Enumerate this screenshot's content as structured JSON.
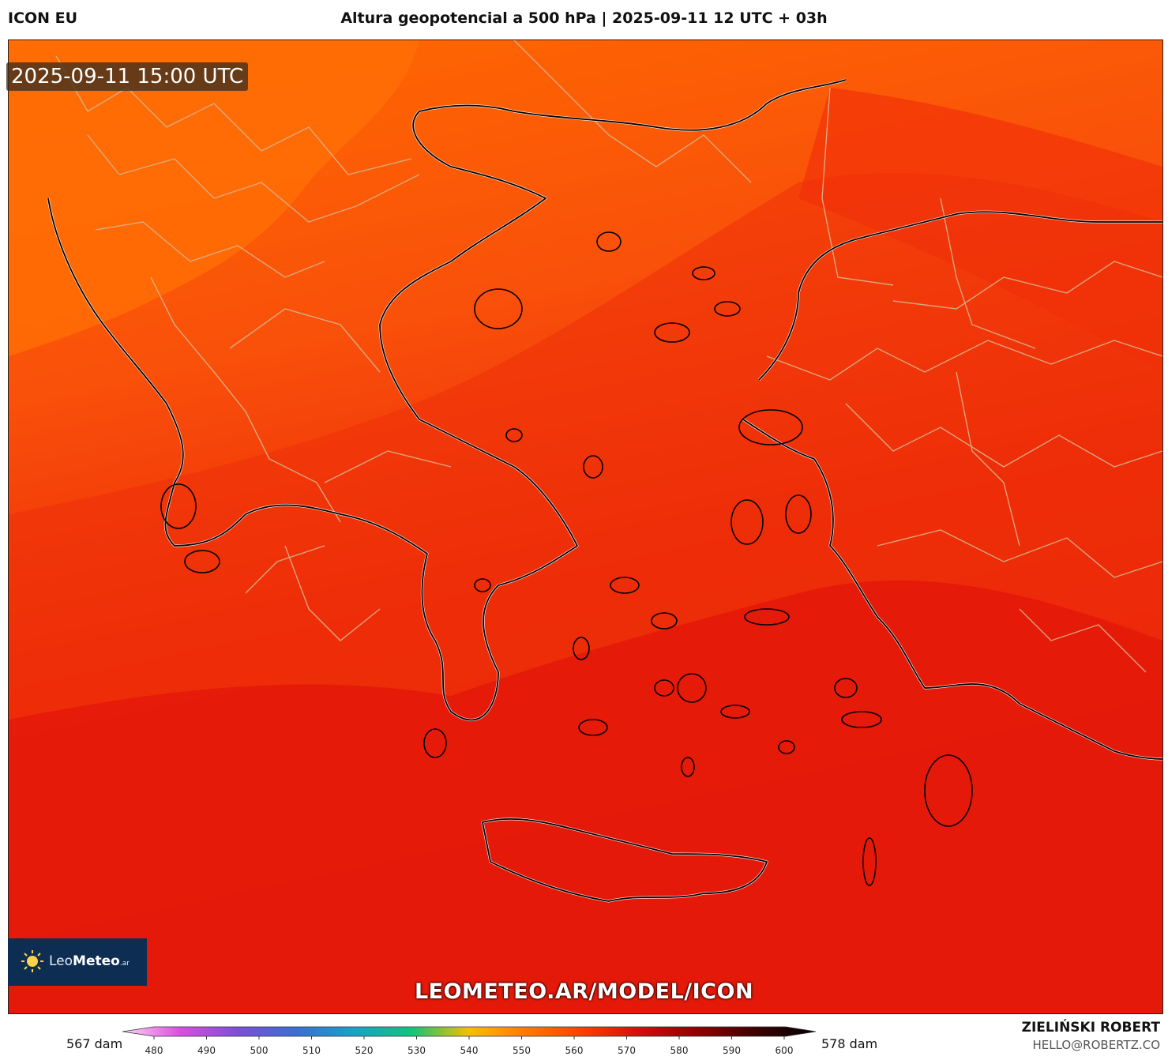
{
  "header": {
    "model": "ICON EU",
    "title": "Altura geopotencial a 500 hPa | 2025-09-11 12 UTC + 03h"
  },
  "map": {
    "timestamp": "2025-09-11 15:00 UTC",
    "region": "Greece / Aegean Sea",
    "colors": {
      "low_fill": "#ff5a00",
      "mid_fill": "#f43a08",
      "high_fill": "#e8190a",
      "coastline": "#000000",
      "border": "#c9a27a",
      "inner_coast": "#ffffff"
    }
  },
  "branding": {
    "logo_text_light": "Leo",
    "logo_text_bold": "Meteo",
    "logo_suffix": ".ar",
    "watermark": "LEOMETEO.AR/MODEL/ICON"
  },
  "colorbar": {
    "unit": "dam",
    "min_label": "567 dam",
    "max_label": "578 dam",
    "ticks": [
      "480",
      "490",
      "500",
      "510",
      "520",
      "530",
      "540",
      "550",
      "560",
      "570",
      "580",
      "590",
      "600"
    ],
    "stops": [
      "#ffd6f5",
      "#d94fe0",
      "#7b4fd6",
      "#3a6fd1",
      "#1aa0c8",
      "#15c27a",
      "#f5c000",
      "#ff7a00",
      "#ff3b00",
      "#d40a0a",
      "#8a0000",
      "#3a0000",
      "#000000"
    ]
  },
  "credit": {
    "name": "ZIELIŃSKI ROBERT",
    "email": "HELLO@ROBERTZ.CO"
  }
}
